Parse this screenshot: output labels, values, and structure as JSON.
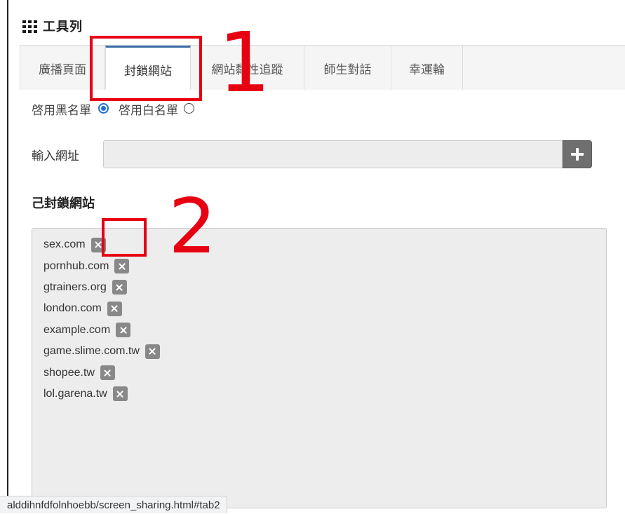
{
  "toolbar": {
    "title": "工具列",
    "icon": "grid-icon"
  },
  "tabs": [
    {
      "label": "廣播頁面",
      "active": false
    },
    {
      "label": "封鎖網站",
      "active": true
    },
    {
      "label": "網站黏性追蹤",
      "active": false
    },
    {
      "label": "師生對話",
      "active": false
    },
    {
      "label": "幸運輪",
      "active": false
    }
  ],
  "mode": {
    "blacklist_label": "啓用黑名單",
    "whitelist_label": "啓用白名單",
    "selected": "blacklist"
  },
  "url_input": {
    "label": "輸入網址",
    "value": "",
    "placeholder": "",
    "add_icon": "plus-icon"
  },
  "blocked": {
    "title": "己封鎖網站",
    "sites": [
      "sex.com",
      "pornhub.com",
      "gtrainers.org",
      "london.com",
      "example.com",
      "game.slime.com.tw",
      "shopee.tw",
      "lol.garena.tw"
    ],
    "remove_icon": "x-icon"
  },
  "status_bar": {
    "url": "alddihnfdfolnhoebb/screen_sharing.html#tab2"
  },
  "annotations": {
    "label_1": "1",
    "label_2": "2",
    "color": "#e60012"
  },
  "colors": {
    "radio_selected": "#1e6fd9",
    "active_tab_top": "#3c6fa8",
    "remove_button": "#888888",
    "add_button": "#6f6f6f"
  }
}
